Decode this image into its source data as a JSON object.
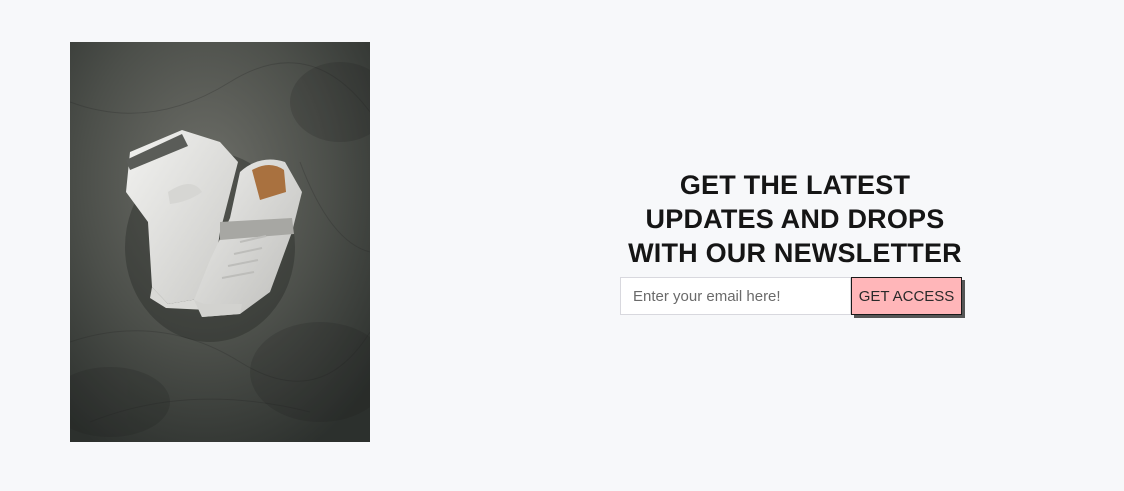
{
  "newsletter": {
    "headline_lines": [
      "GET THE LATEST",
      "UPDATES AND DROPS",
      "WITH OUR NEWSLETTER"
    ],
    "email_placeholder": "Enter your email here!",
    "email_value": "",
    "submit_label": "GET ACCESS"
  },
  "image": {
    "subject": "white-high-top-sneakers-on-concrete"
  },
  "colors": {
    "background": "#f7f8fa",
    "button_bg": "#ffb6b9",
    "headline": "#151515"
  }
}
